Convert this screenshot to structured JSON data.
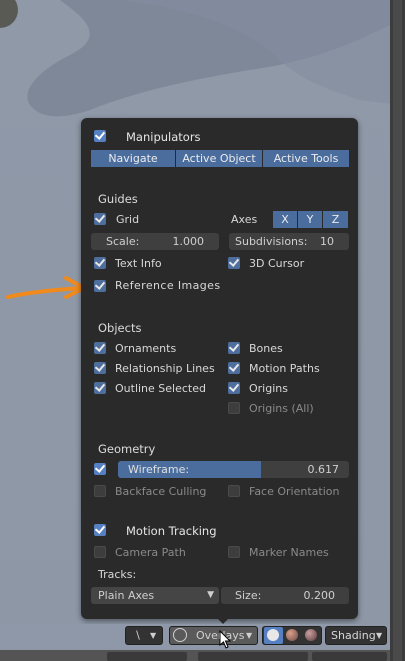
{
  "colors": {
    "accent": "#5680c2",
    "panel": "#2a2a2a",
    "annotation": "#f08a1c"
  },
  "manipulators": {
    "label": "Manipulators",
    "tabs": [
      "Navigate",
      "Active Object",
      "Active Tools"
    ]
  },
  "guides": {
    "heading": "Guides",
    "grid": "Grid",
    "axes_label": "Axes",
    "axes": [
      "X",
      "Y",
      "Z"
    ],
    "scale_label": "Scale:",
    "scale_value": "1.000",
    "subdiv_label": "Subdivisions:",
    "subdiv_value": "10",
    "text_info": "Text Info",
    "cursor": "3D Cursor",
    "ref_images": "Reference Images"
  },
  "objects": {
    "heading": "Objects",
    "ornaments": "Ornaments",
    "bones": "Bones",
    "relationship_lines": "Relationship Lines",
    "motion_paths": "Motion Paths",
    "outline_selected": "Outline Selected",
    "origins": "Origins",
    "origins_all": "Origins (All)"
  },
  "geometry": {
    "heading": "Geometry",
    "wireframe_label": "Wireframe:",
    "wireframe_value": "0.617",
    "wireframe_fraction": 0.617,
    "backface": "Backface Culling",
    "face_orientation": "Face Orientation"
  },
  "motion": {
    "label": "Motion Tracking",
    "camera_path": "Camera Path",
    "marker_names": "Marker Names",
    "tracks_label": "Tracks:",
    "tracks_value": "Plain Axes",
    "size_label": "Size:",
    "size_value": "0.200"
  },
  "header": {
    "overlays": "Overlays",
    "shading": "Shading"
  }
}
